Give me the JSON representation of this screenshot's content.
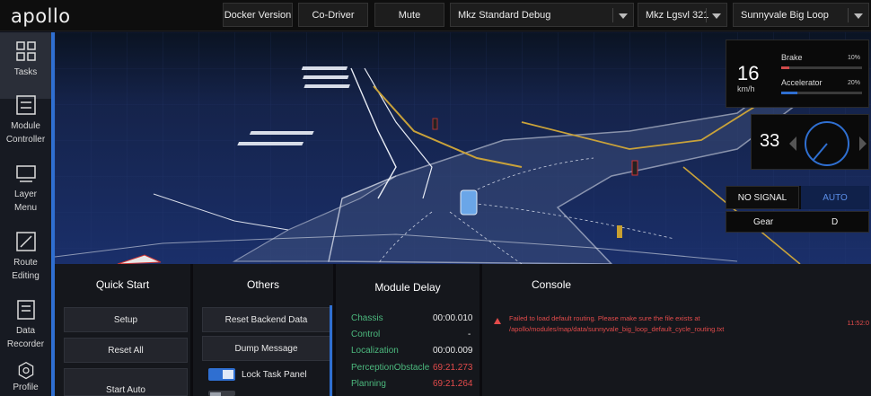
{
  "header": {
    "logo": "apollo",
    "buttons": [
      "Docker Version",
      "Co-Driver",
      "Mute"
    ],
    "mode_select": "Mkz Standard Debug",
    "vehicle_select": "Mkz Lgsvl 321",
    "map_select": "Sunnyvale Big Loop"
  },
  "sidebar": {
    "items": [
      {
        "label": "Tasks",
        "icon": "grid-icon",
        "active": true
      },
      {
        "label": "Module Controller",
        "icon": "module-controller-icon"
      },
      {
        "label": "Layer Menu",
        "icon": "layer-icon"
      },
      {
        "label": "Route Editing",
        "icon": "route-editing-icon"
      },
      {
        "label": "Data Recorder",
        "icon": "data-recorder-icon"
      },
      {
        "label": "Profile",
        "icon": "profile-icon"
      }
    ]
  },
  "dashboard": {
    "speed": "16",
    "speed_unit": "km/h",
    "brake_label": "Brake",
    "brake_pct": "10%",
    "brake_level": 0.1,
    "accel_label": "Accelerator",
    "accel_pct": "20%",
    "accel_level": 0.2,
    "steering": "33",
    "signal": "NO SIGNAL",
    "drive_mode": "AUTO",
    "gear_label": "Gear",
    "gear_value": "D"
  },
  "colors": {
    "accent": "#2f6fd1",
    "module_name": "#4cb97e",
    "error": "#e34b4b"
  },
  "quick_start": {
    "title": "Quick Start",
    "buttons": [
      "Setup",
      "Reset All",
      "Start Auto"
    ]
  },
  "others": {
    "title": "Others",
    "buttons": [
      "Reset Backend Data",
      "Dump Message"
    ],
    "toggles": [
      {
        "label": "Lock Task Panel",
        "on": true
      }
    ]
  },
  "module_delay": {
    "title": "Module Delay",
    "rows": [
      {
        "name": "Chassis",
        "value": "00:00.010",
        "error": false
      },
      {
        "name": "Control",
        "value": "-",
        "error": false
      },
      {
        "name": "Localization",
        "value": "00:00.009",
        "error": false
      },
      {
        "name": "PerceptionObstacle",
        "value": "69:21.273",
        "error": true
      },
      {
        "name": "Planning",
        "value": "69:21.264",
        "error": true
      }
    ]
  },
  "console": {
    "title": "Console",
    "message_line1": "Failed to load default routing. Please make sure the file exists at",
    "message_line2": "/apollo/modules/map/data/sunnyvale_big_loop_default_cycle_routing.txt",
    "time": "11:52:0"
  }
}
